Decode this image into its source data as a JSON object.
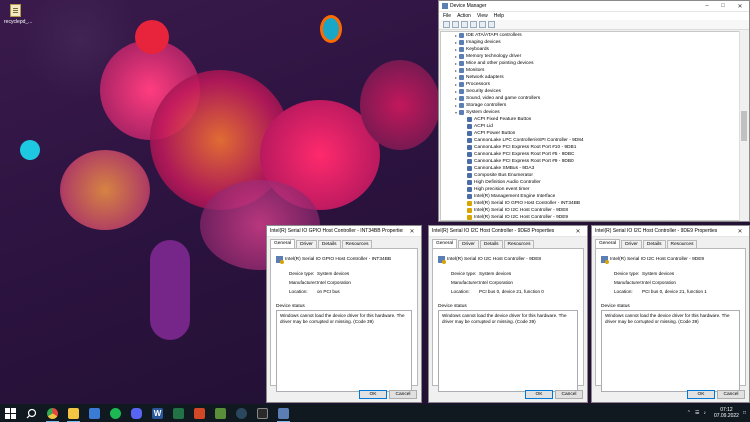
{
  "desktop": {
    "icon_label": "recyclepd_..."
  },
  "device_manager": {
    "title": "Device Manager",
    "menu": [
      "File",
      "Action",
      "View",
      "Help"
    ],
    "categories": [
      "IDE ATA/ATAPI controllers",
      "Imaging devices",
      "Keyboards",
      "Memory technology driver",
      "Mice and other pointing devices",
      "Monitors",
      "Network adapters",
      "Processors",
      "Security devices",
      "Sound, video and game controllers",
      "Storage controllers",
      "System devices"
    ],
    "system_devices": [
      "ACPI Fixed Feature Button",
      "ACPI Lid",
      "ACPI Power Button",
      "CannonLake LPC Controller/eSPI Controller - 9D84",
      "CannonLake PCI Express Root Port #10 - 9DB1",
      "CannonLake PCI Express Root Port #5 - 9DBC",
      "CannonLake PCI Express Root Port #9 - 9DB0",
      "CannonLake SMBus - 9DA3",
      "Composite Bus Enumerator",
      "High Definition Audio Controller",
      "High precision event timer",
      "Intel(R) Management Engine Interface",
      "Intel(R) Serial IO GPIO Host Controller - INT34BB",
      "Intel(R) Serial IO I2C Host Controller - 9DE8",
      "Intel(R) Serial IO I2C Host Controller - 9DE9"
    ]
  },
  "dialogs": [
    {
      "title": "Intel(R) Serial IO GPIO Host Controller - INT34BB Properties",
      "tabs": [
        "General",
        "Driver",
        "Details",
        "Resources"
      ],
      "device_name": "Intel(R) Serial IO GPIO Host Controller - INT34BB",
      "device_type_label": "Device type:",
      "device_type": "System devices",
      "manufacturer_label": "Manufacturer:",
      "manufacturer": "Intel Corporation",
      "location_label": "Location:",
      "location": "on PCI bus",
      "status_label": "Device status",
      "status_text": "Windows cannot load the device driver for this hardware. The driver may be corrupted or missing. (Code 39)",
      "ok": "OK",
      "cancel": "Cancel"
    },
    {
      "title": "Intel(R) Serial IO I2C Host Controller - 9DE8 Properties",
      "tabs": [
        "General",
        "Driver",
        "Details",
        "Resources"
      ],
      "device_name": "Intel(R) Serial IO I2C Host Controller - 9DE8",
      "device_type_label": "Device type:",
      "device_type": "System devices",
      "manufacturer_label": "Manufacturer:",
      "manufacturer": "Intel Corporation",
      "location_label": "Location:",
      "location": "PCI bus 0, device 21, function 0",
      "status_label": "Device status",
      "status_text": "Windows cannot load the device driver for this hardware. The driver may be corrupted or missing. (Code 39)",
      "ok": "OK",
      "cancel": "Cancel"
    },
    {
      "title": "Intel(R) Serial IO I2C Host Controller - 9DE9 Properties",
      "tabs": [
        "General",
        "Driver",
        "Details",
        "Resources"
      ],
      "device_name": "Intel(R) Serial IO I2C Host Controller - 9DE9",
      "device_type_label": "Device type:",
      "device_type": "System devices",
      "manufacturer_label": "Manufacturer:",
      "manufacturer": "Intel Corporation",
      "location_label": "Location:",
      "location": "PCI bus 0, device 21, function 1",
      "status_label": "Device status",
      "status_text": "Windows cannot load the device driver for this hardware. The driver may be corrupted or missing. (Code 39)",
      "ok": "OK",
      "cancel": "Cancel"
    }
  ],
  "taskbar": {
    "apps": [
      {
        "name": "start-icon",
        "color": "#ffffff"
      },
      {
        "name": "search-icon",
        "color": "#ffffff"
      },
      {
        "name": "chrome-icon",
        "color": "#e8453c"
      },
      {
        "name": "file-explorer-icon",
        "color": "#f4c542"
      },
      {
        "name": "store-icon",
        "color": "#3a7bd5"
      },
      {
        "name": "spotify-icon",
        "color": "#1db954"
      },
      {
        "name": "discord-icon",
        "color": "#5865f2"
      },
      {
        "name": "word-icon",
        "color": "#2b579a"
      },
      {
        "name": "excel-icon",
        "color": "#217346"
      },
      {
        "name": "powerpoint-icon",
        "color": "#d24726"
      },
      {
        "name": "minecraft-icon",
        "color": "#5a8f3a"
      },
      {
        "name": "steam-icon",
        "color": "#1b2838"
      },
      {
        "name": "epic-games-icon",
        "color": "#2a2a2a"
      },
      {
        "name": "device-manager-icon",
        "color": "#5b7fb5"
      }
    ],
    "time": "07:12",
    "date": "07.09.2022"
  }
}
